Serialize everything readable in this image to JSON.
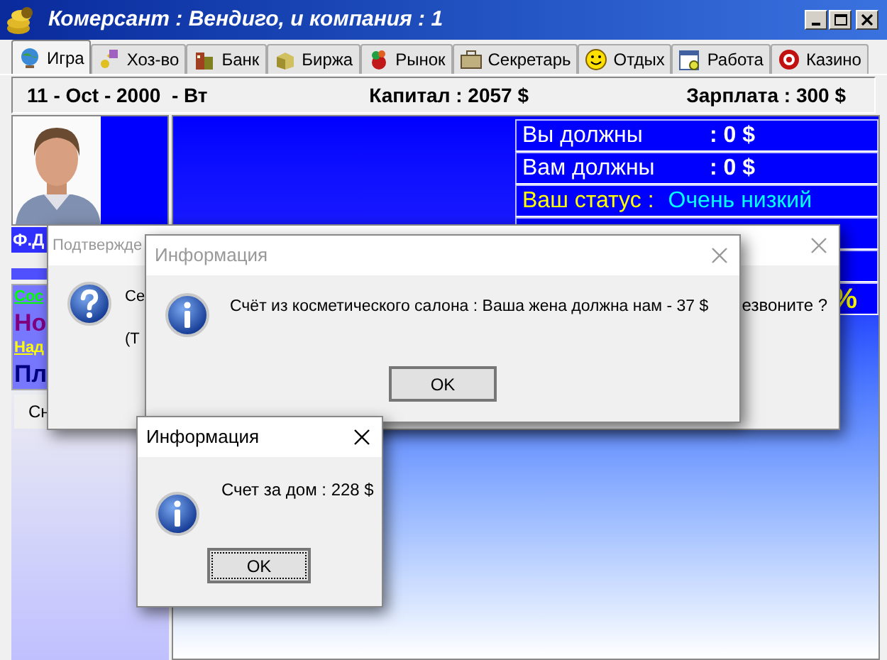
{
  "window": {
    "title": "Комерсант : Вендиго, и компания : 1"
  },
  "tabs": [
    {
      "label": "Игра",
      "selected": true
    },
    {
      "label": "Хоз-во",
      "selected": false
    },
    {
      "label": "Банк",
      "selected": false
    },
    {
      "label": "Биржа",
      "selected": false
    },
    {
      "label": "Рынок",
      "selected": false
    },
    {
      "label": "Секретарь",
      "selected": false
    },
    {
      "label": "Отдых",
      "selected": false
    },
    {
      "label": "Работа",
      "selected": false
    },
    {
      "label": "Казино",
      "selected": false
    }
  ],
  "info_bar": {
    "date": "11 - Oct - 2000  - Вт",
    "capital": "Капитал : 2057 $",
    "salary": "Зарплата : 300 $"
  },
  "player": {
    "name": "Ф.Д",
    "stats": [
      {
        "text": "Сос",
        "color": "#00ff00",
        "kind": "link"
      },
      {
        "text": "Но",
        "color": "#800080",
        "kind": "large"
      },
      {
        "text": "Над",
        "color": "#ffff00",
        "kind": "link"
      },
      {
        "text": "Пл",
        "color": "#000080",
        "kind": "large"
      }
    ],
    "button": "Сн"
  },
  "finance": [
    {
      "kind": "amount",
      "label": "Вы должны",
      "value": ": 0 $"
    },
    {
      "kind": "amount",
      "label": "Вам должны",
      "value": ": 0 $"
    },
    {
      "kind": "status",
      "label": "Ваш статус :",
      "value": "Очень низкий"
    },
    {
      "kind": "percent",
      "value": "%"
    }
  ],
  "dialogs": [
    {
      "kind": "question",
      "title": "Подтвержде",
      "active": false,
      "lines": [
        "Се",
        "(Т"
      ],
      "tail": "езвоните ?"
    },
    {
      "kind": "info",
      "title": "Информация",
      "active": false,
      "message": "Счёт из косметического салона : Ваша жена должна нам - 37 $",
      "button": "OK",
      "focused": false
    },
    {
      "kind": "info",
      "title": "Информация",
      "active": true,
      "message": "Счет за дом : 228 $",
      "button": "OK",
      "focused": true
    }
  ]
}
